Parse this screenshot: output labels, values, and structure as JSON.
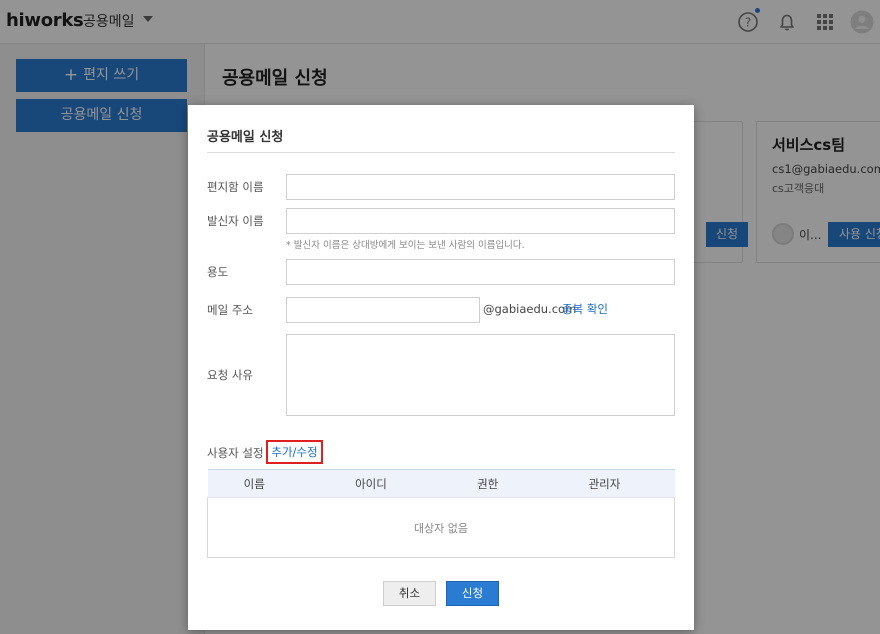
{
  "header": {
    "logo": "hiworks",
    "app_name": "공용메일",
    "icons": [
      "help-icon",
      "bell-icon",
      "apps-grid-icon",
      "user-avatar-icon"
    ]
  },
  "sidebar": {
    "write_label": "편지 쓰기",
    "apply_label": "공용메일 신청"
  },
  "main": {
    "title": "공용메일 신청",
    "cards": [
      {
        "name": "",
        "button": "신청"
      },
      {
        "name": "서비스cs팀",
        "email": "cs1@gabiaedu.com",
        "desc": "cs고객응대",
        "user": "이...",
        "button": "사용 신청"
      }
    ]
  },
  "modal": {
    "title": "공용메일 신청",
    "fields": {
      "mailbox_name_label": "편지함 이름",
      "sender_name_label": "발신자 이름",
      "sender_hint": "* 발신자 이름은 상대방에게 보이는 보낸 사람의 이름입니다.",
      "purpose_label": "용도",
      "email_label": "메일 주소",
      "email_domain": "@gabiaedu.com",
      "dup_check": "중복 확인",
      "reason_label": "요청 사유"
    },
    "users": {
      "label": "사용자 설정",
      "edit_link": "추가/수정",
      "columns": [
        "이름",
        "아이디",
        "권한",
        "관리자"
      ],
      "empty_text": "대상자 없음"
    },
    "buttons": {
      "cancel": "취소",
      "submit": "신청"
    }
  },
  "colors": {
    "accent": "#2a7bd2",
    "link": "#1e6fc5",
    "highlight_border": "#e02020"
  }
}
